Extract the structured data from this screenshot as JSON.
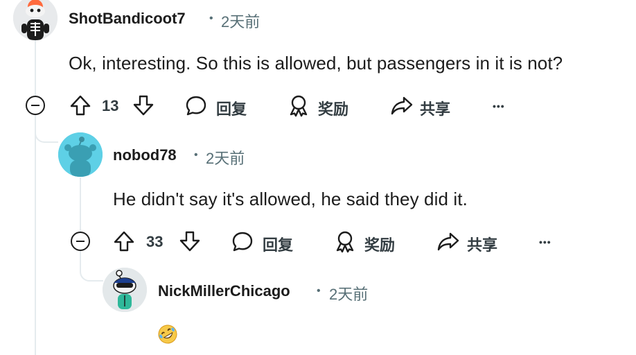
{
  "comments": [
    {
      "username": "ShotBandicoot7",
      "separator": "•",
      "time": "2天前",
      "body": "Ok, interesting. So this is allowed, but passengers in it is not?",
      "upvotes": "13",
      "reply_label": "回复",
      "award_label": "奖励",
      "share_label": "共享",
      "more_label": "•••"
    },
    {
      "username": "nobod78",
      "separator": "•",
      "time": "2天前",
      "body": "He didn't say it's allowed, he said they did it.",
      "upvotes": "33",
      "reply_label": "回复",
      "award_label": "奖励",
      "share_label": "共享",
      "more_label": "•••"
    },
    {
      "username": "NickMillerChicago",
      "separator": "•",
      "time": "2天前",
      "body_emoji": "rolling-on-floor-laughing-emoji"
    }
  ],
  "colors": {
    "text": "#1c1c1c",
    "meta": "#576f76",
    "thread_line": "#e5ebee",
    "avatar2_bg": "#5ed0e6"
  }
}
